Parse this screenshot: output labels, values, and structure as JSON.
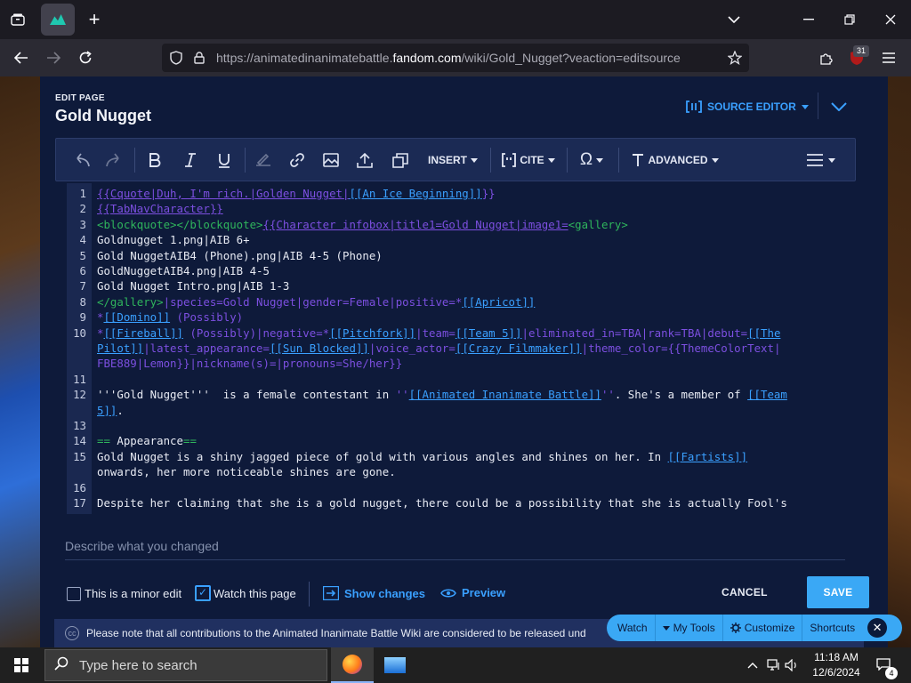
{
  "browser": {
    "tab_icon": "fandom-wiki-favicon",
    "new_tab_label": "+",
    "url_prefix": "https://animatedinanimatebattle.",
    "url_domain": "fandom.com",
    "url_path": "/wiki/Gold_Nugget?veaction=editsource",
    "extension_badge": "31"
  },
  "editor": {
    "kicker": "EDIT PAGE",
    "title": "Gold Nugget",
    "source_editor_label": "SOURCE EDITOR",
    "toolbar": {
      "insert_label": "INSERT",
      "cite_label": "CITE",
      "advanced_label": "ADVANCED"
    }
  },
  "code_lines": [
    {
      "n": "1",
      "spans": [
        [
          "tpl",
          "{{Cquote|Duh, I'm rich.|Golden Nugget|"
        ],
        [
          "link",
          "[[An Ice Beginning]]"
        ],
        [
          "tpl",
          "}}"
        ]
      ]
    },
    {
      "n": "2",
      "spans": [
        [
          "tpl",
          "{{TabNavCharacter}}"
        ]
      ]
    },
    {
      "n": "3",
      "spans": [
        [
          "tag",
          "<blockquote></blockquote>"
        ],
        [
          "tpl",
          "{{Character infobox|title1=Gold Nugget|image1="
        ],
        [
          "tag",
          "<gallery>"
        ]
      ]
    },
    {
      "n": "4",
      "spans": [
        [
          "plain",
          "Goldnugget 1.png|AIB 6+"
        ]
      ]
    },
    {
      "n": "5",
      "spans": [
        [
          "plain",
          "Gold NuggetAIB4 (Phone).png|AIB 4-5 (Phone)"
        ]
      ]
    },
    {
      "n": "6",
      "spans": [
        [
          "plain",
          "GoldNuggetAIB4.png|AIB 4-5"
        ]
      ]
    },
    {
      "n": "7",
      "spans": [
        [
          "plain",
          "Gold Nugget Intro.png|AIB 1-3"
        ]
      ]
    },
    {
      "n": "8",
      "spans": [
        [
          "tag",
          "</gallery>"
        ],
        [
          "tpl",
          "|species=Gold Nugget|gender=Female|positive=*"
        ],
        [
          "link",
          "[[Apricot]]"
        ]
      ]
    },
    {
      "n": "9",
      "spans": [
        [
          "tpl",
          "*"
        ],
        [
          "link",
          "[[Domino]]"
        ],
        [
          "tpl",
          " (Possibly)"
        ]
      ]
    },
    {
      "n": "10",
      "spans": [
        [
          "tpl",
          "*"
        ],
        [
          "link",
          "[[Fireball]]"
        ],
        [
          "tpl",
          " (Possibly)|negative=*"
        ],
        [
          "link",
          "[[Pitchfork]]"
        ],
        [
          "tpl",
          "|team="
        ],
        [
          "link",
          "[[Team 5]]"
        ],
        [
          "tpl",
          "|eliminated_in=TBA|rank=TBA|debut="
        ],
        [
          "link",
          "[[The"
        ]
      ]
    },
    {
      "n": "",
      "spans": [
        [
          "link",
          "Pilot]]"
        ],
        [
          "tpl",
          "|latest_appearance="
        ],
        [
          "link",
          "[[Sun Blocked]]"
        ],
        [
          "tpl",
          "|voice_actor="
        ],
        [
          "link",
          "[[Crazy Filmmaker]]"
        ],
        [
          "tpl",
          "|theme_color={{ThemeColorText|"
        ]
      ]
    },
    {
      "n": "",
      "spans": [
        [
          "tpl",
          "FBE889|Lemon}}|nickname(s)=|pronouns=She/her}}"
        ]
      ]
    },
    {
      "n": "11",
      "spans": []
    },
    {
      "n": "12",
      "spans": [
        [
          "plain",
          "'''Gold Nugget'''  is a female contestant in "
        ],
        [
          "tpl",
          "''"
        ],
        [
          "link",
          "[[Animated Inanimate Battle]]"
        ],
        [
          "tpl",
          "''"
        ],
        [
          "plain",
          ". She's a member of "
        ],
        [
          "link",
          "[[Team"
        ]
      ]
    },
    {
      "n": "",
      "spans": [
        [
          "link",
          "5]]"
        ],
        [
          "plain",
          "."
        ]
      ]
    },
    {
      "n": "13",
      "spans": []
    },
    {
      "n": "14",
      "spans": [
        [
          "tag",
          "=="
        ],
        [
          "plain",
          " Appearance"
        ],
        [
          "tag",
          "=="
        ]
      ]
    },
    {
      "n": "15",
      "spans": [
        [
          "plain",
          "Gold Nugget is a shiny jagged piece of gold with various angles and shines on her. In "
        ],
        [
          "link",
          "[[Fartists]]"
        ]
      ]
    },
    {
      "n": "",
      "spans": [
        [
          "plain",
          "onwards, her more noticeable shines are gone."
        ]
      ]
    },
    {
      "n": "16",
      "spans": []
    },
    {
      "n": "17",
      "spans": [
        [
          "plain",
          "Despite her claiming that she is a gold nugget, there could be a possibility that she is actually Fool's"
        ]
      ]
    }
  ],
  "footer": {
    "summary_placeholder": "Describe what you changed",
    "minor_edit_label": "This is a minor edit",
    "watch_page_label": "Watch this page",
    "show_changes_label": "Show changes",
    "preview_label": "Preview",
    "cancel_label": "CANCEL",
    "save_label": "SAVE",
    "notice_text": "Please note that all contributions to the Animated Inanimate Battle Wiki are considered to be released und"
  },
  "toolsbar": {
    "watch": "Watch",
    "my_tools": "My Tools",
    "customize": "Customize",
    "shortcuts": "Shortcuts"
  },
  "taskbar": {
    "search_placeholder": "Type here to search",
    "time": "11:18 AM",
    "date": "12/6/2024",
    "notification_count": "4"
  }
}
